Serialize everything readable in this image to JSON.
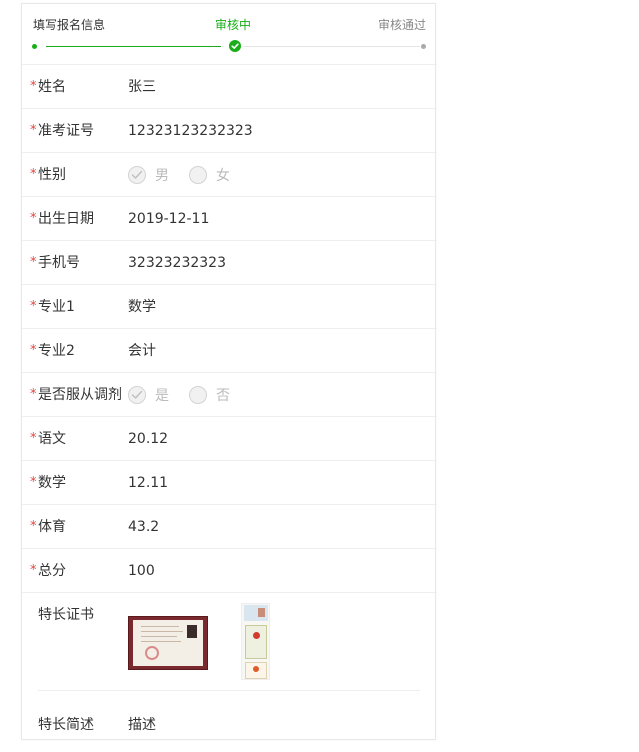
{
  "steps": [
    "填写报名信息",
    "审核中",
    "审核通过"
  ],
  "fields": [
    {
      "label": "姓名",
      "value": "张三"
    },
    {
      "label": "准考证号",
      "value": "12323123232323"
    },
    {
      "label": "性别",
      "options": [
        "男",
        "女"
      ],
      "selected": "男"
    },
    {
      "label": "出生日期",
      "value": "2019-12-11"
    },
    {
      "label": "手机号",
      "value": "32323232323"
    },
    {
      "label": "专业1",
      "value": "数学"
    },
    {
      "label": "专业2",
      "value": "会计"
    },
    {
      "label": "是否服从调剂",
      "options": [
        "是",
        "否"
      ],
      "selected": "是"
    },
    {
      "label": "语文",
      "value": "20.12"
    },
    {
      "label": "数学",
      "value": "12.11"
    },
    {
      "label": "体育",
      "value": "43.2"
    },
    {
      "label": "总分",
      "value": "100"
    }
  ],
  "required_mark": "*",
  "certificate": {
    "label": "特长证书"
  },
  "description": {
    "label": "特长简述",
    "value": "描述"
  },
  "colors": {
    "accent": "#1aad19",
    "required": "#e64340",
    "border": "#eeeeee"
  }
}
